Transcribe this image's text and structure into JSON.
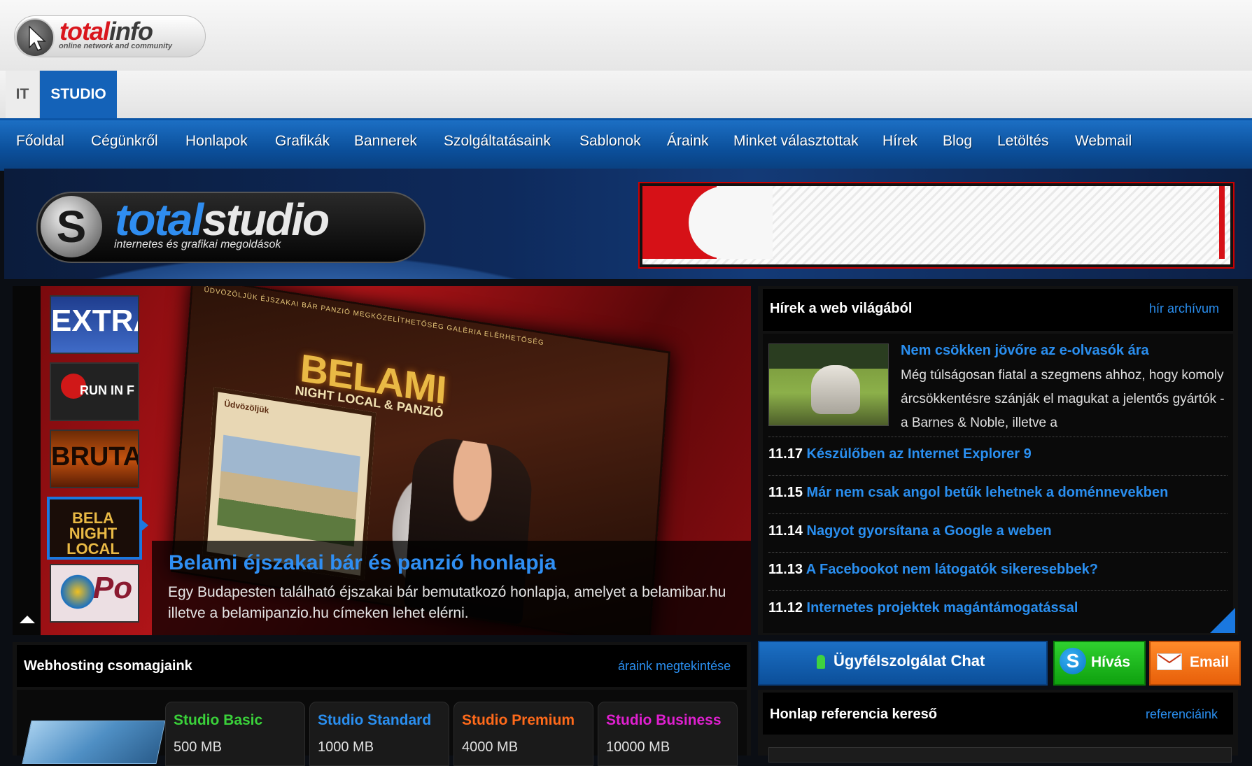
{
  "header": {
    "logo_total": "total",
    "logo_info": "info",
    "logo_tagline": "online network and community"
  },
  "tabs": [
    {
      "label": "IT",
      "active": false
    },
    {
      "label": "STUDIO",
      "active": true
    }
  ],
  "nav": {
    "items": [
      "Főoldal",
      "Cégünkről",
      "Honlapok",
      "Grafikák",
      "Bannerek",
      "Szolgáltatásaink",
      "Sablonok",
      "Áraink",
      "Minket választottak",
      "Hírek",
      "Blog",
      "Letöltés",
      "Webmail"
    ]
  },
  "banner": {
    "logo_total": "total",
    "logo_studio": "studio",
    "tagline": "internetes és grafikai megoldások"
  },
  "showcase": {
    "thumbs": [
      "EXTRA",
      "RUN IN F",
      "BRUTA",
      "BELA NIGHT LOCAL",
      "Po"
    ],
    "active_thumb": 3,
    "site_menu": "ÜDVÖZÖLJÜK   ÉJSZAKAI BÁR   PANZIÓ   MEGKÖZELÍTHETŐSÉG   GALÉRIA   ELÉRHETŐSÉG",
    "site_logo": "BELAMI",
    "site_logo_sub": "NIGHT LOCAL & PANZIÓ",
    "site_panel_heading": "Üdvözöljük",
    "title": "Belami éjszakai bár és panzió honlapja",
    "description": "Egy Budapesten található éjszakai bár bemutatkozó honlapja, amelyet a belamibar.hu illetve a belamipanzio.hu címeken lehet elérni."
  },
  "news": {
    "title": "Hírek a web világából",
    "archive_link": "hír archívum",
    "featured": {
      "title": "Nem csökken jövőre az e-olvasók ára",
      "text": "Még túlságosan fiatal a szegmens ahhoz, hogy komoly árcsökkentésre szánják el magukat a jelentős gyártók - a Barnes & Noble, illetve a"
    },
    "items": [
      {
        "date": "11.17",
        "title": "Készülőben az Internet Explorer 9"
      },
      {
        "date": "11.15",
        "title": "Már nem csak angol betűk lehetnek a doménnevekben"
      },
      {
        "date": "11.14",
        "title": "Nagyot gyorsítana a Google a weben"
      },
      {
        "date": "11.13",
        "title": "A Facebookot nem látogatók sikeresebbek?"
      },
      {
        "date": "11.12",
        "title": "Internetes projektek magántámogatással"
      }
    ]
  },
  "contact": {
    "chat": "Ügyfélszolgálat Chat",
    "call": "Hívás",
    "email": "Email"
  },
  "reference": {
    "title": "Honlap referencia kereső",
    "link": "referenciáink"
  },
  "hosting": {
    "title": "Webhosting csomagjaink",
    "link": "áraink megtekintése",
    "plans": [
      {
        "name": "Studio Basic",
        "size": "500 MB",
        "color": "#3ad13a"
      },
      {
        "name": "Studio Standard",
        "size": "1000 MB",
        "color": "#2a8ff0"
      },
      {
        "name": "Studio Premium",
        "size": "4000 MB",
        "color": "#ff6a1a"
      },
      {
        "name": "Studio Business",
        "size": "10000 MB",
        "color": "#e020d0"
      }
    ]
  },
  "colors": {
    "accent_blue": "#2a8ff0",
    "nav_blue": "#0b4f9a",
    "brand_red": "#d9151c"
  }
}
